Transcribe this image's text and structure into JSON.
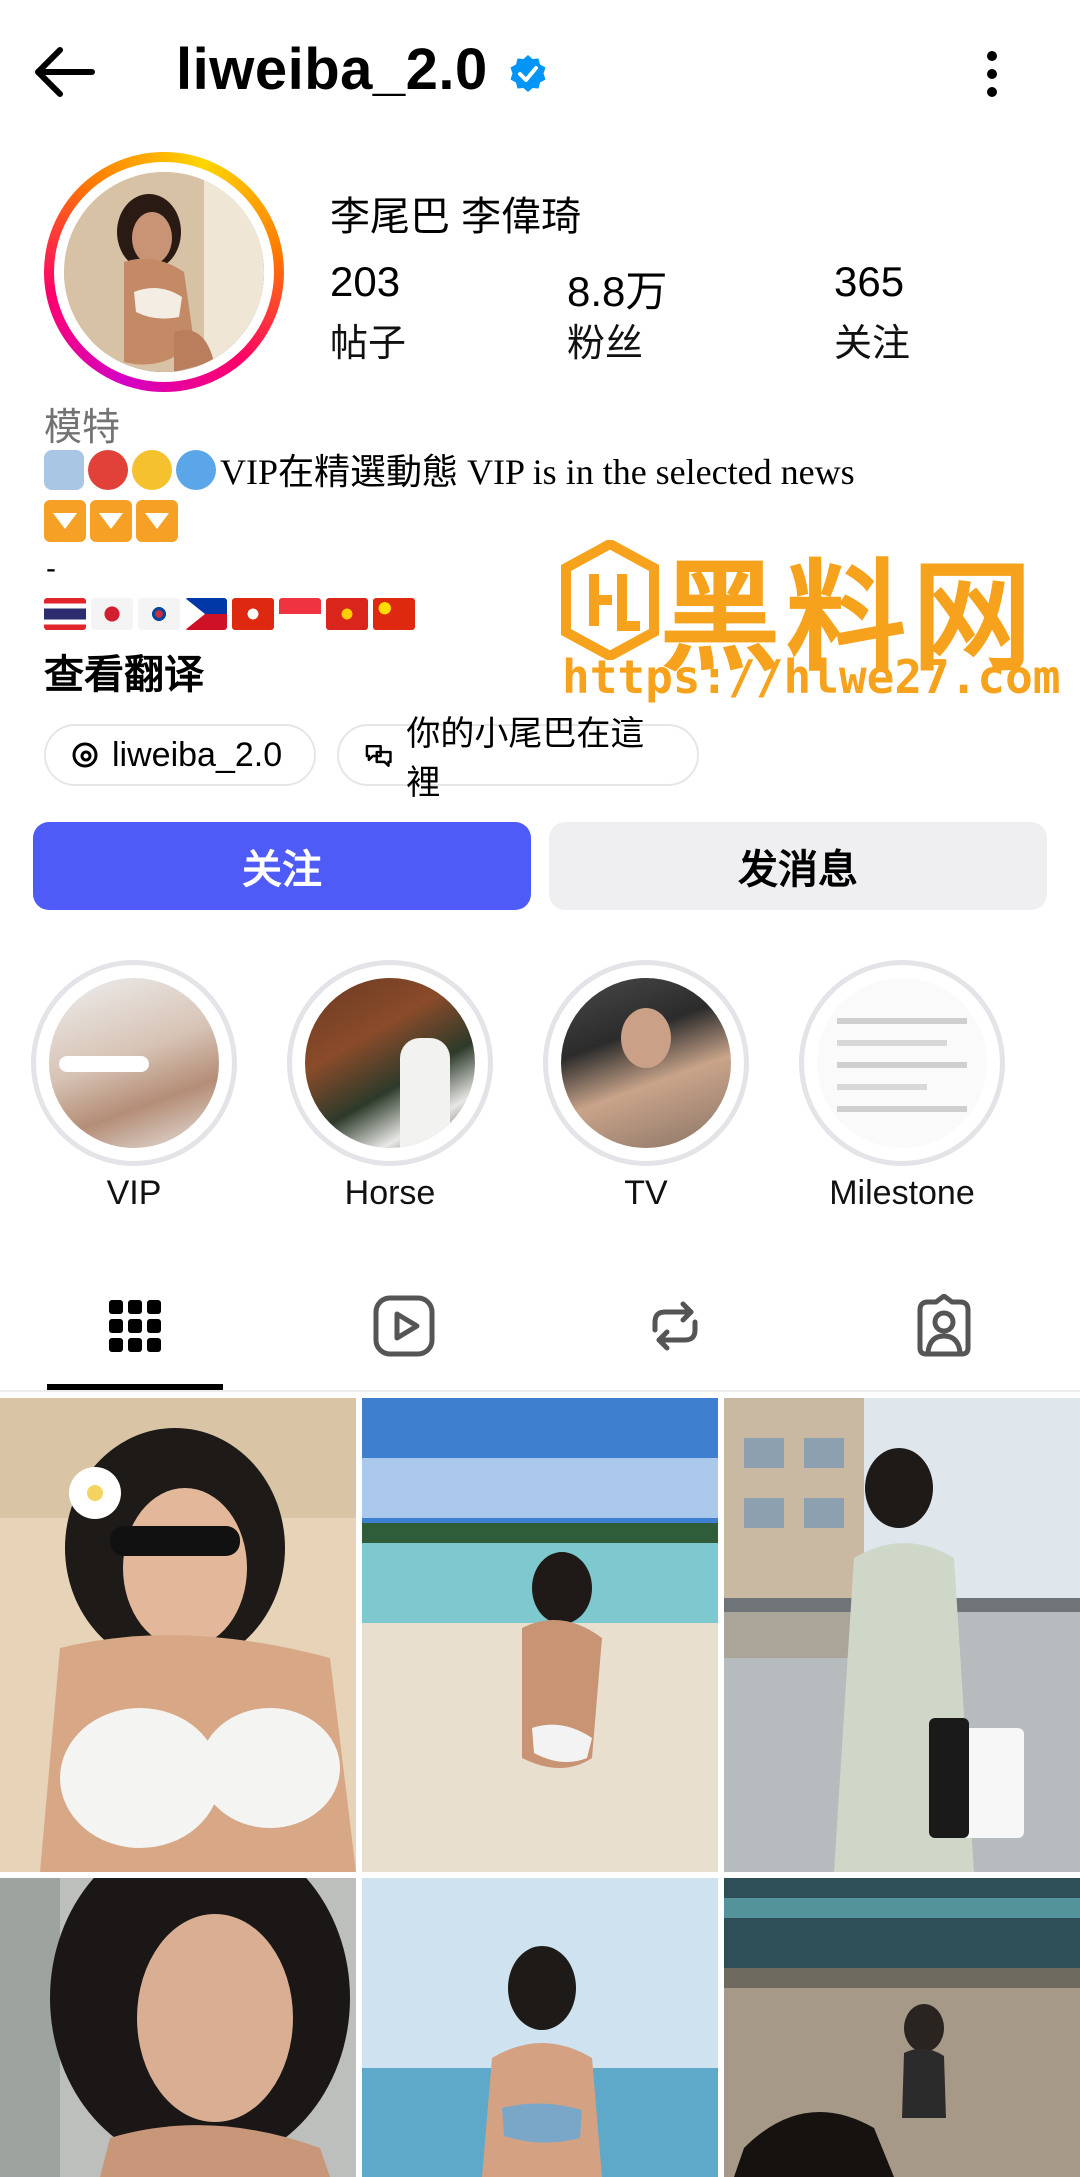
{
  "header": {
    "username": "liweiba_2.0",
    "verified": true,
    "back_icon": "arrow-left-icon",
    "more_icon": "more-vertical-icon"
  },
  "profile": {
    "full_name": "李尾巴 李偉琦",
    "stats": [
      {
        "value": "203",
        "label": "帖子"
      },
      {
        "value": "8.8万",
        "label": "粉丝"
      },
      {
        "value": "365",
        "label": "关注"
      }
    ],
    "category": "模特",
    "bio_line1": "VIP在精選動態 VIP is in the selected news",
    "bio_dash": "-",
    "translate_label": "查看翻译"
  },
  "watermark": {
    "title": "黑料网",
    "url": "https://hlwe27.com"
  },
  "chips": [
    {
      "label": "liweiba_2.0",
      "icon": "threads-icon"
    },
    {
      "label": "你的小尾巴在這裡",
      "icon": "chat-bubbles-icon"
    }
  ],
  "actions": {
    "follow_label": "关注",
    "message_label": "发消息"
  },
  "highlights": [
    {
      "label": "VIP"
    },
    {
      "label": "Horse"
    },
    {
      "label": "TV"
    },
    {
      "label": "Milestone"
    }
  ],
  "tabs": [
    {
      "name": "posts",
      "icon": "grid-icon",
      "active": true
    },
    {
      "name": "reels",
      "icon": "reels-play-icon",
      "active": false
    },
    {
      "name": "reposts",
      "icon": "repost-icon",
      "active": false
    },
    {
      "name": "tagged",
      "icon": "tagged-person-icon",
      "active": false
    }
  ],
  "colors": {
    "follow_button": "#4f5bf6",
    "verified": "#0095f6",
    "watermark": "#f6a21c"
  }
}
